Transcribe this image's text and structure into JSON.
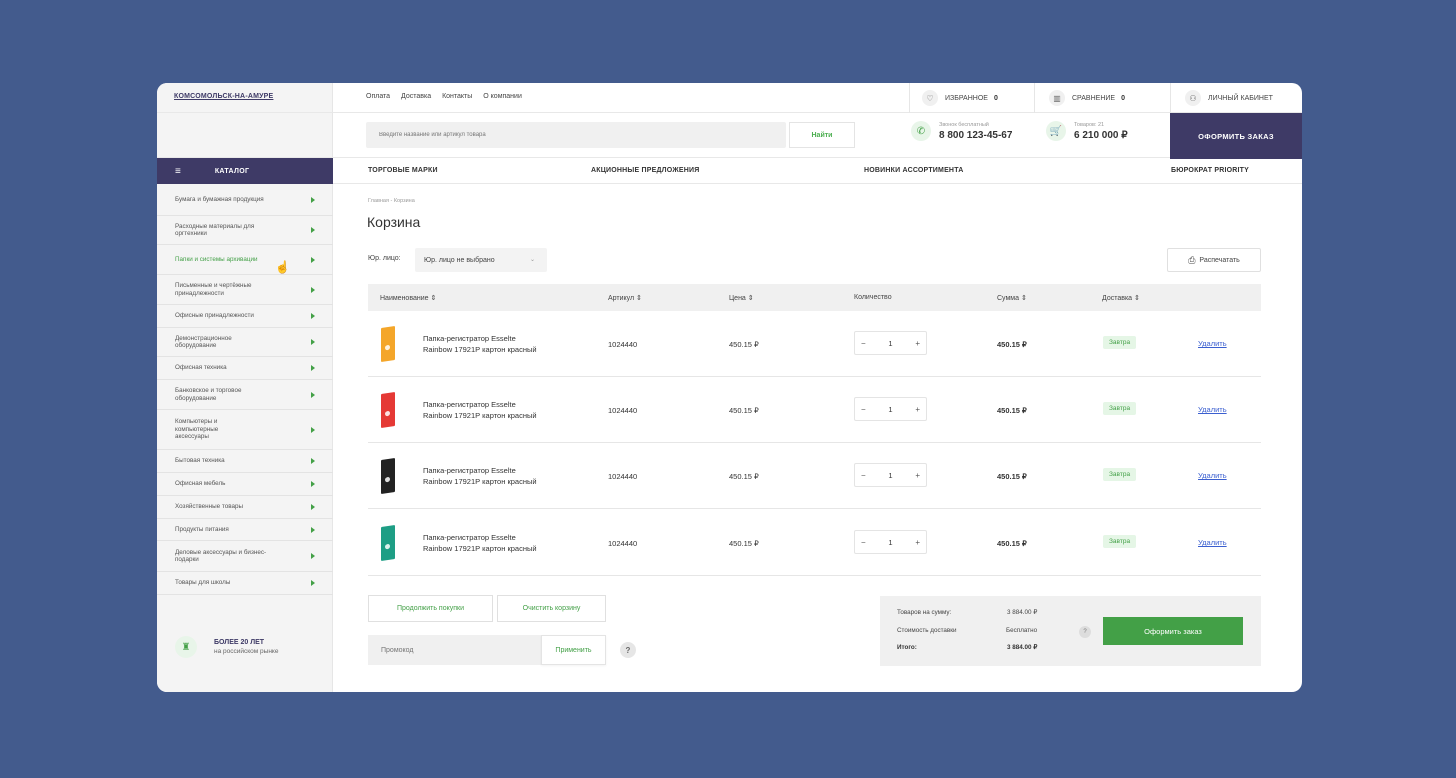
{
  "topbar": {
    "city": "КОМСОМОЛЬСК-НА-АМУРЕ",
    "links": [
      "Оплата",
      "Доставка",
      "Контакты",
      "О компании"
    ],
    "favorites_label": "ИЗБРАННОЕ",
    "favorites_count": "0",
    "compare_label": "СРАВНЕНИЕ",
    "compare_count": "0",
    "account_label": "ЛИЧНЫЙ КАБИНЕТ"
  },
  "search": {
    "placeholder": "Введите название или артикул товара",
    "button": "Найти"
  },
  "phone": {
    "caption": "Звонок бесплатный",
    "number": "8 800 123-45-67"
  },
  "cart_summary": {
    "caption": "Товаров: 21",
    "amount": "6 210 000 ₽"
  },
  "order_top_button": "ОФОРМИТЬ ЗАКАЗ",
  "catalog_label": "КАТАЛОГ",
  "catnav": [
    "ТОРГОВЫЕ МАРКИ",
    "АКЦИОННЫЕ ПРЕДЛОЖЕНИЯ",
    "НОВИНКИ АССОРТИМЕНТА",
    "БЮРОКРАТ PRIORITY"
  ],
  "sidebar": {
    "items": [
      {
        "label": "Бумага и бумажная продукция",
        "active": false
      },
      {
        "label": "Расходные материалы для оргтехники",
        "active": false
      },
      {
        "label": "Папки и системы архивации",
        "active": true
      },
      {
        "label": "Письменные и чертёжные принадлежности",
        "active": false
      },
      {
        "label": "Офисные принадлежности",
        "active": false
      },
      {
        "label": "Демонстрационное оборудование",
        "active": false
      },
      {
        "label": "Офисная техника",
        "active": false
      },
      {
        "label": "Банковское и торговое оборудование",
        "active": false
      },
      {
        "label": "Компьютеры и компьютерные аксессуары",
        "active": false
      },
      {
        "label": "Бытовая техника",
        "active": false
      },
      {
        "label": "Офисная мебель",
        "active": false
      },
      {
        "label": "Хозяйственные товары",
        "active": false
      },
      {
        "label": "Продукты питания",
        "active": false
      },
      {
        "label": "Деловые аксессуары и бизнес-подарки",
        "active": false
      },
      {
        "label": "Товары для школы",
        "active": false
      }
    ],
    "badge_title": "БОЛЕЕ 20 ЛЕТ",
    "badge_subtitle": "на российском рынке"
  },
  "breadcrumb": "Главная - Корзина",
  "page_title": "Корзина",
  "legal": {
    "label": "Юр. лицо:",
    "value": "Юр. лицо не выбрано"
  },
  "print_label": "Распечатать",
  "table": {
    "headers": {
      "name": "Наименование ⇕",
      "sku": "Артикул ⇕",
      "price": "Цена ⇕",
      "qty": "Количество",
      "sum": "Сумма ⇕",
      "delivery": "Доставка ⇕"
    },
    "rows": [
      {
        "name1": "Папка-регистратор Esselte",
        "name2": "Rainbow 17921P картон красный",
        "sku": "1024440",
        "price": "450.15 ₽",
        "qty": "1",
        "sum": "450.15 ₽",
        "delivery": "Завтра",
        "delete": "Удалить",
        "color": "#f4a62a"
      },
      {
        "name1": "Папка-регистратор Esselte",
        "name2": "Rainbow 17921P картон красный",
        "sku": "1024440",
        "price": "450.15 ₽",
        "qty": "1",
        "sum": "450.15 ₽",
        "delivery": "Завтра",
        "delete": "Удалить",
        "color": "#e53935"
      },
      {
        "name1": "Папка-регистратор Esselte",
        "name2": "Rainbow 17921P картон красный",
        "sku": "1024440",
        "price": "450.15 ₽",
        "qty": "1",
        "sum": "450.15 ₽",
        "delivery": "Завтра",
        "delete": "Удалить",
        "color": "#222222"
      },
      {
        "name1": "Папка-регистратор Esselte",
        "name2": "Rainbow 17921P картон красный",
        "sku": "1024440",
        "price": "450.15 ₽",
        "qty": "1",
        "sum": "450.15 ₽",
        "delivery": "Завтра",
        "delete": "Удалить",
        "color": "#1e9e85"
      }
    ]
  },
  "buttons": {
    "continue": "Продолжить покупки",
    "clear": "Очистить корзину",
    "apply": "Применить",
    "checkout": "Оформить заказ"
  },
  "promo": {
    "placeholder": "Промокод"
  },
  "totals": {
    "goods_label": "Товаров на сумму:",
    "goods_value": "3 884.00 ₽",
    "delivery_label": "Стоимость доставки",
    "delivery_value": "Бесплатно",
    "total_label": "Итого:",
    "total_value": "3 884.00 ₽"
  },
  "colors": {
    "background": "#435b8d",
    "brand_dark": "#3e3a66",
    "accent_green": "#43a047",
    "link_blue": "#3b5fd0"
  }
}
